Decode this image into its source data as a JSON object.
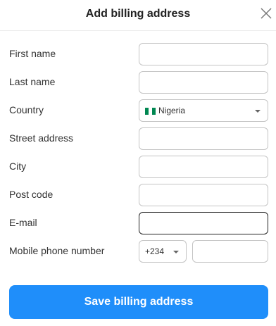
{
  "dialog": {
    "title": "Add billing address",
    "close_icon": "close-icon"
  },
  "form": {
    "first_name": {
      "label": "First name",
      "value": ""
    },
    "last_name": {
      "label": "Last name",
      "value": ""
    },
    "country": {
      "label": "Country",
      "value": "Nigeria",
      "flag_icon": "nigeria-flag-icon",
      "flag_colors": [
        "#008751",
        "#ffffff",
        "#008751"
      ]
    },
    "street_address": {
      "label": "Street address",
      "value": ""
    },
    "city": {
      "label": "City",
      "value": ""
    },
    "post_code": {
      "label": "Post code",
      "value": ""
    },
    "email": {
      "label": "E-mail",
      "value": ""
    },
    "mobile_phone": {
      "label": "Mobile phone number",
      "code": "+234",
      "value": ""
    }
  },
  "actions": {
    "save_label": "Save billing address"
  },
  "colors": {
    "accent": "#1f8efa",
    "border": "#c4c4c4",
    "focused_border": "#222222"
  }
}
